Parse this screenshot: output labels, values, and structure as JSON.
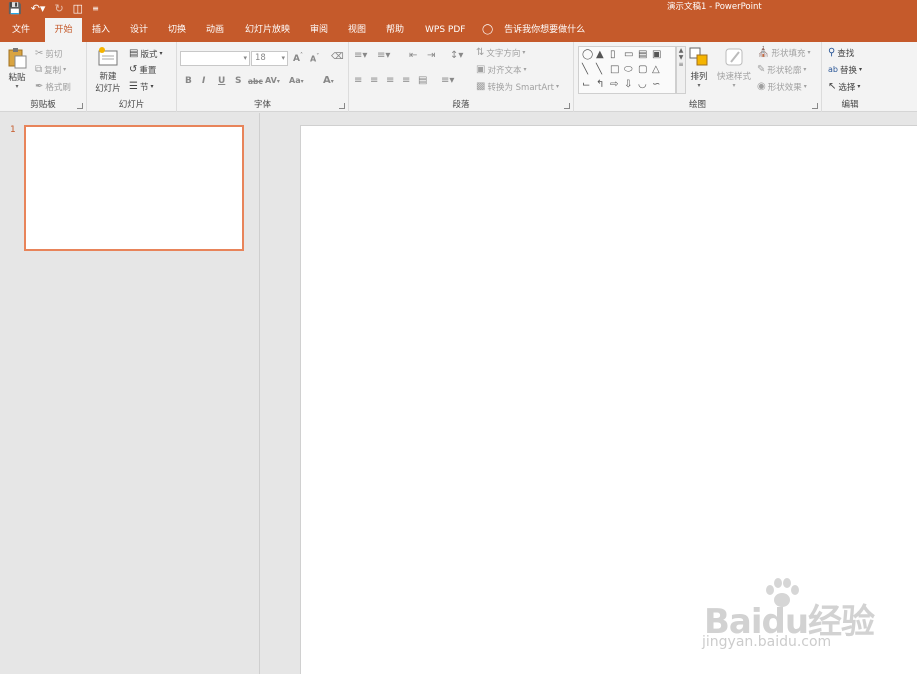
{
  "window": {
    "title": "演示文稿1 - PowerPoint",
    "accent_color": "#c55a2b"
  },
  "quick_access": {
    "items": [
      "save-icon",
      "undo-icon",
      "redo-icon",
      "start-slideshow-icon",
      "customize-qat-icon"
    ]
  },
  "tabs": [
    {
      "label": "文件",
      "active": false
    },
    {
      "label": "开始",
      "active": true
    },
    {
      "label": "插入",
      "active": false
    },
    {
      "label": "设计",
      "active": false
    },
    {
      "label": "切换",
      "active": false
    },
    {
      "label": "动画",
      "active": false
    },
    {
      "label": "幻灯片放映",
      "active": false
    },
    {
      "label": "审阅",
      "active": false
    },
    {
      "label": "视图",
      "active": false
    },
    {
      "label": "帮助",
      "active": false
    },
    {
      "label": "WPS PDF",
      "active": false
    }
  ],
  "tell_me": "告诉我你想要做什么",
  "ribbon": {
    "clipboard": {
      "label": "剪贴板",
      "paste": "粘贴",
      "cut": "剪切",
      "copy": "复制",
      "format_painter": "格式刷"
    },
    "slides": {
      "label": "幻灯片",
      "new_slide_line1": "新建",
      "new_slide_line2": "幻灯片",
      "layout": "版式",
      "reset": "重置",
      "section": "节"
    },
    "font": {
      "label": "字体",
      "font_name": "",
      "font_size": "18",
      "bold": "B",
      "italic": "I",
      "underline": "U",
      "shadow": "S",
      "strikethrough": "abc",
      "char_spacing": "AV",
      "change_case": "Aa",
      "font_color": "A",
      "grow": "A",
      "shrink": "A"
    },
    "paragraph": {
      "label": "段落",
      "text_direction": "文字方向",
      "align_text": "对齐文本",
      "convert_smartart": "转换为 SmartArt"
    },
    "drawing": {
      "label": "绘图",
      "arrange": "排列",
      "quick_styles": "快速样式",
      "shape_fill": "形状填充",
      "shape_outline": "形状轮廓",
      "shape_effects": "形状效果"
    },
    "editing": {
      "label": "编辑",
      "find": "查找",
      "replace": "替换",
      "select": "选择"
    }
  },
  "slides_panel": {
    "slides": [
      {
        "number": "1"
      }
    ]
  },
  "watermark": {
    "brand": "Baidu经验",
    "url": "jingyan.baidu.com"
  }
}
